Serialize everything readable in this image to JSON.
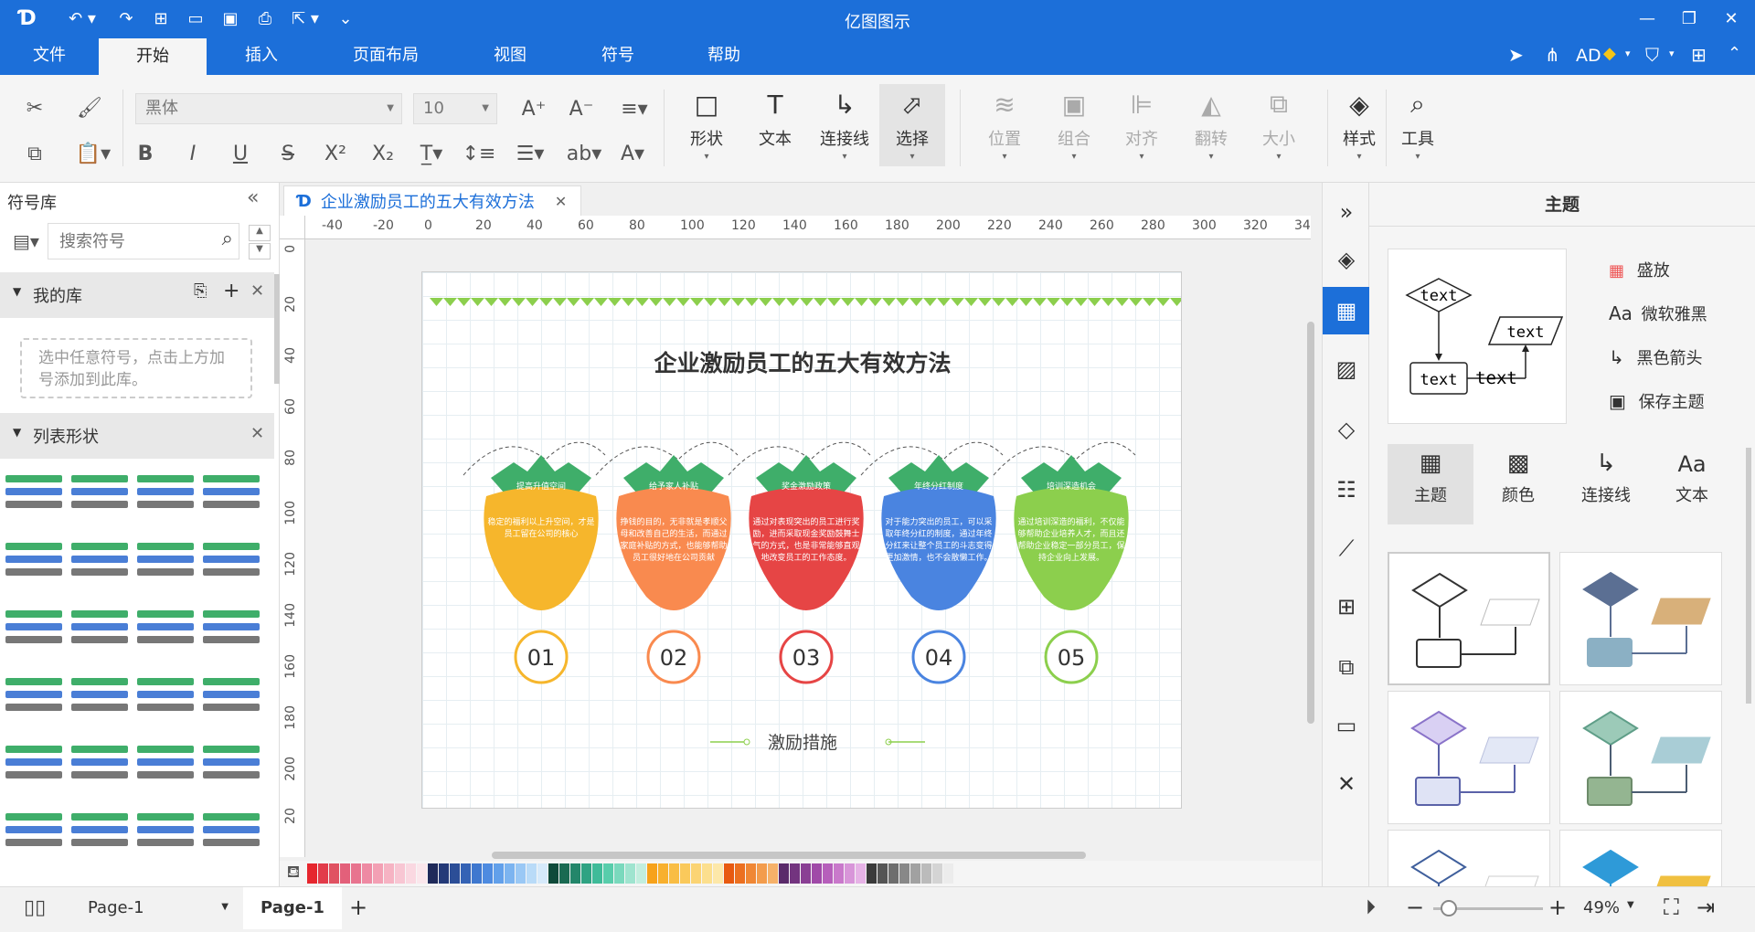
{
  "app": {
    "title": "亿图图示"
  },
  "titlebar": {
    "user": "AD"
  },
  "menu": {
    "tabs": [
      "文件",
      "开始",
      "插入",
      "页面布局",
      "视图",
      "符号",
      "帮助"
    ]
  },
  "ribbon": {
    "font_name": "黑体",
    "font_size": "10",
    "big_buttons": [
      {
        "label": "形状",
        "icon": "□"
      },
      {
        "label": "文本",
        "icon": "T"
      },
      {
        "label": "连接线",
        "icon": "↳"
      },
      {
        "label": "选择",
        "icon": "⬀"
      },
      {
        "label": "位置",
        "icon": "≋"
      },
      {
        "label": "组合",
        "icon": "▣"
      },
      {
        "label": "对齐",
        "icon": "⊫"
      },
      {
        "label": "翻转",
        "icon": "◭"
      },
      {
        "label": "大小",
        "icon": "⧉"
      },
      {
        "label": "样式",
        "icon": "◈"
      },
      {
        "label": "工具",
        "icon": "⌕"
      }
    ]
  },
  "left": {
    "title": "符号库",
    "search_placeholder": "搜索符号",
    "mylib": "我的库",
    "mylib_hint": "选中任意符号，点击上方加号添加到此库。",
    "list_shapes": "列表形状"
  },
  "document": {
    "tab": "企业激励员工的五大有效方法"
  },
  "ruler": {
    "h": [
      "-40",
      "-20",
      "0",
      "20",
      "40",
      "60",
      "80",
      "100",
      "120",
      "140",
      "160",
      "180",
      "200",
      "220",
      "240",
      "260",
      "280",
      "300",
      "320",
      "34"
    ],
    "v": [
      "0",
      "20",
      "40",
      "60",
      "80",
      "100",
      "120",
      "140",
      "160",
      "180",
      "200",
      "20"
    ]
  },
  "diagram": {
    "title": "企业激励员工的五大有效方法",
    "footer": "激励措施",
    "items": [
      {
        "num": "01",
        "label": "提高升值空间",
        "text": "稳定的福利以上升空间，才是员工留在公司的核心",
        "color": "#f6b62c",
        "ring": "#f6b62c"
      },
      {
        "num": "02",
        "label": "给予家人补贴",
        "text": "挣钱的目的，无非就是孝顺父母和改善自己的生活，而通过家庭补贴的方式，也能够帮助员工很好地在公司贡献",
        "color": "#f98a4f",
        "ring": "#f98a4f"
      },
      {
        "num": "03",
        "label": "奖金激励政策",
        "text": "通过对表现突出的员工进行奖励，进而采取现金奖励鼓舞士气的方式，也是非常能够直观地改变员工的工作态度。",
        "color": "#e64545",
        "ring": "#e64545"
      },
      {
        "num": "04",
        "label": "年终分红制度",
        "text": "对于能力突出的员工，可以采取年终分红的制度，通过年终分红来让整个员工的斗志变得更加激情，也不会散懒工作。",
        "color": "#4a84e0",
        "ring": "#4a84e0"
      },
      {
        "num": "05",
        "label": "培训深造机会",
        "text": "通过培训深造的福利，不仅能够帮助企业培养人才，而且还帮助企业稳定一部分员工，保持企业向上发展。",
        "color": "#8ccf4d",
        "ring": "#8ccf4d"
      }
    ]
  },
  "theme": {
    "title": "主题",
    "options": [
      "盛放",
      "微软雅黑",
      "黑色箭头",
      "保存主题"
    ],
    "preview_text": "text",
    "tabs": [
      "主题",
      "颜色",
      "连接线",
      "文本"
    ]
  },
  "status": {
    "page_select": "Page-1",
    "page_tab": "Page-1",
    "zoom": "49%"
  },
  "palette": [
    "#e6262e",
    "#e23b4a",
    "#e05262",
    "#e3607a",
    "#e8748f",
    "#ee8aa3",
    "#f3a0b4",
    "#f6b3c3",
    "#f8c6d3",
    "#fad8e1",
    "#fbe7ec",
    "#1f2a5a",
    "#243a78",
    "#2c4e97",
    "#3563b5",
    "#3f78cf",
    "#4e8be0",
    "#62a0ea",
    "#7cb4f0",
    "#9ac8f5",
    "#b9dbf8",
    "#d6eafb",
    "#0f4a3a",
    "#1a6a52",
    "#23866a",
    "#2fa383",
    "#3fbb99",
    "#58cdab",
    "#7ad9bd",
    "#9fe4cf",
    "#c2eede",
    "#f7a21b",
    "#f8b02e",
    "#f9bd44",
    "#fac95b",
    "#fbd474",
    "#fcdf8e",
    "#fde8a9",
    "#e85a10",
    "#ec7020",
    "#f08734",
    "#f39c4c",
    "#f6b169",
    "#5a2a6a",
    "#73347f",
    "#8a3f94",
    "#a04aa8",
    "#b65fbb",
    "#c979cb",
    "#d895d9",
    "#e6b2e6",
    "#3a3a3a",
    "#555",
    "#6e6e6e",
    "#888",
    "#a1a1a1",
    "#bbb",
    "#d4d4d4",
    "#ececec"
  ]
}
